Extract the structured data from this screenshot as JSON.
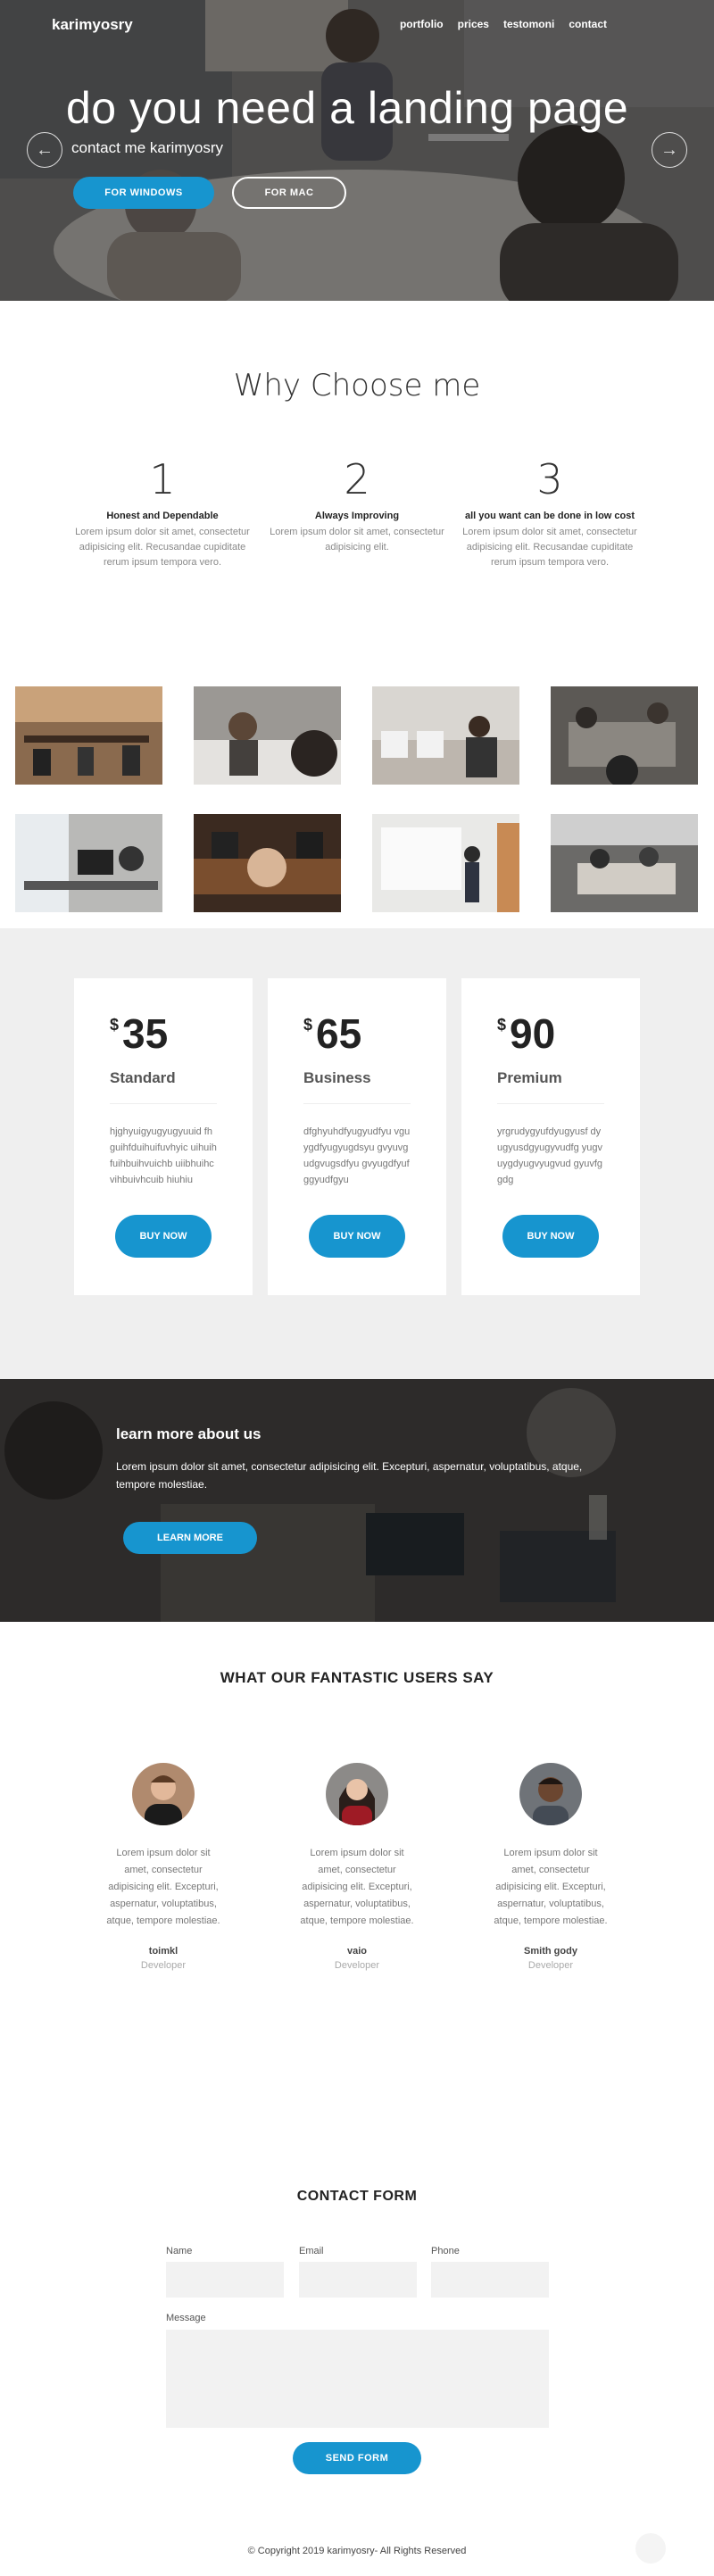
{
  "header": {
    "brand": "karimyosry",
    "nav": [
      "portfolio",
      "prices",
      "testomoni",
      "contact"
    ]
  },
  "hero": {
    "title": "do you need a landing page",
    "subtitle": "contact me karimyosry",
    "btn_windows": "FOR WINDOWS",
    "btn_mac": "FOR MAC",
    "prev_icon": "←",
    "next_icon": "→"
  },
  "why": {
    "title": "Why Choose me",
    "features": [
      {
        "num": "1",
        "title": "Honest and Dependable",
        "text": "Lorem ipsum dolor sit amet, consectetur adipisicing elit. Recusandae cupiditate rerum ipsum tempora vero."
      },
      {
        "num": "2",
        "title": "Always Improving",
        "text": "Lorem ipsum dolor sit amet, consectetur adipisicing elit."
      },
      {
        "num": "3",
        "title": "all you want can be done in low cost",
        "text": "Lorem ipsum dolor sit amet, consectetur adipisicing elit. Recusandae cupiditate rerum ipsum tempora vero."
      }
    ]
  },
  "pricing": {
    "plans": [
      {
        "currency": "$",
        "amount": "35",
        "name": "Standard",
        "desc": "hjghyuigyugyugyuuid fhguihfduihuifuvhyic uihuihfuihbuihvuichb uiibhuihcvihbuivhcuib hiuhiu",
        "button": "BUY NOW"
      },
      {
        "currency": "$",
        "amount": "65",
        "name": "Business",
        "desc": "dfghyuhdfyugyudfyu vguygdfyugyugdsyu gvyuvgudgvugsdfyu gvyugdfyufggyudfgyu",
        "button": "BUY NOW"
      },
      {
        "currency": "$",
        "amount": "90",
        "name": "Premium",
        "desc": "yrgrudygyufdyugyusf dyugyusdgyugyvudfg yugvuygdyugvyugvud gyuvfggdg",
        "button": "BUY NOW"
      }
    ]
  },
  "learn": {
    "title": "learn more about us",
    "text": "Lorem ipsum dolor sit amet, consectetur adipisicing elit. Excepturi, aspernatur, voluptatibus, atque, tempore molestiae.",
    "button": "LEARN MORE"
  },
  "testimonials": {
    "title": "WHAT OUR FANTASTIC USERS SAY",
    "items": [
      {
        "text": "Lorem ipsum dolor sit amet, consectetur adipisicing elit. Excepturi, aspernatur, voluptatibus, atque, tempore molestiae.",
        "name": "toimkl",
        "role": "Developer"
      },
      {
        "text": "Lorem ipsum dolor sit amet, consectetur adipisicing elit. Excepturi, aspernatur, voluptatibus, atque, tempore molestiae.",
        "name": "vaio",
        "role": "Developer"
      },
      {
        "text": "Lorem ipsum dolor sit amet, consectetur adipisicing elit. Excepturi, aspernatur, voluptatibus, atque, tempore molestiae.",
        "name": "Smith gody",
        "role": "Developer"
      }
    ]
  },
  "contact": {
    "title": "CONTACT FORM",
    "name_label": "Name",
    "email_label": "Email",
    "phone_label": "Phone",
    "message_label": "Message",
    "button": "SEND FORM"
  },
  "footer": {
    "copyright": "© Copyright 2019 karimyosry- All Rights Reserved"
  }
}
